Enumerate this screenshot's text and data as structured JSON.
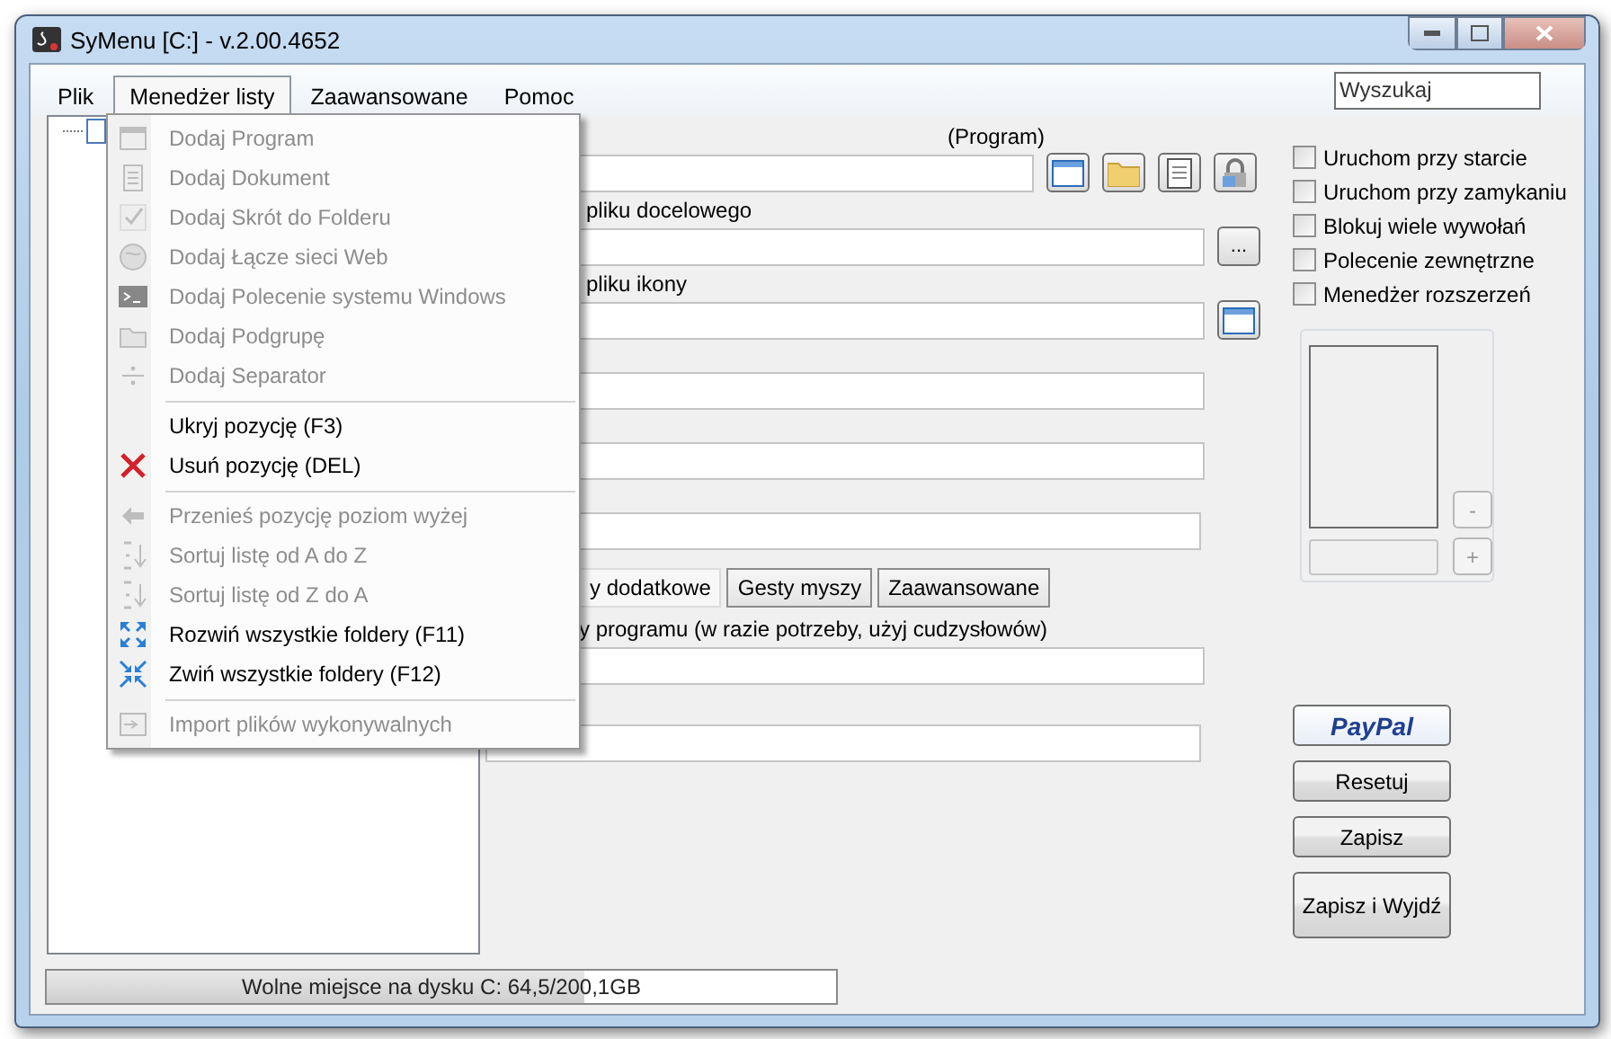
{
  "window": {
    "title": "SyMenu [C:] - v.2.00.4652"
  },
  "menu_bar": [
    {
      "label": "Plik",
      "selected": false
    },
    {
      "label": "Menedżer listy",
      "selected": true
    },
    {
      "label": "Zaawansowane",
      "selected": false
    },
    {
      "label": "Pomoc",
      "selected": false
    }
  ],
  "search": {
    "placeholder": "Wyszukaj"
  },
  "dropdown": [
    {
      "kind": "item",
      "label": "Dodaj Program",
      "disabled": true
    },
    {
      "kind": "item",
      "label": "Dodaj Dokument",
      "disabled": true
    },
    {
      "kind": "item",
      "label": "Dodaj Skrót do Folderu",
      "disabled": true
    },
    {
      "kind": "item",
      "label": "Dodaj Łącze sieci Web",
      "disabled": true
    },
    {
      "kind": "item",
      "label": "Dodaj Polecenie systemu Windows",
      "disabled": true
    },
    {
      "kind": "item",
      "label": "Dodaj Podgrupę",
      "disabled": true
    },
    {
      "kind": "item",
      "label": "Dodaj Separator",
      "disabled": true
    },
    {
      "kind": "separator"
    },
    {
      "kind": "item",
      "label": "Ukryj pozycję (F3)",
      "disabled": false
    },
    {
      "kind": "item",
      "label": "Usuń pozycję (DEL)",
      "disabled": false
    },
    {
      "kind": "separator"
    },
    {
      "kind": "item",
      "label": "Przenieś pozycję poziom wyżej",
      "disabled": true
    },
    {
      "kind": "item",
      "label": "Sortuj listę od A do Z",
      "disabled": true
    },
    {
      "kind": "item",
      "label": "Sortuj listę od Z do A",
      "disabled": true
    },
    {
      "kind": "item",
      "label": "Rozwiń wszystkie foldery (F11)",
      "disabled": false
    },
    {
      "kind": "item",
      "label": "Zwiń wszystkie foldery (F12)",
      "disabled": false
    },
    {
      "kind": "separator"
    },
    {
      "kind": "item",
      "label": "Import plików wykonywalnych",
      "disabled": true
    }
  ],
  "form": {
    "type_label": "(Program)",
    "target_label": "pliku docelowego",
    "browse_button": "...",
    "icon_label": "pliku ikony",
    "tabs": [
      {
        "label": "y dodatkowe",
        "selected": true
      },
      {
        "label": "Gesty myszy",
        "selected": false
      },
      {
        "label": "Zaawansowane",
        "selected": false
      }
    ],
    "args_label": "y programu (w razie potrzeby, użyj cudzysłowów)"
  },
  "options": [
    {
      "label": "Uruchom przy starcie",
      "checked": false
    },
    {
      "label": "Uruchom przy zamykaniu",
      "checked": false
    },
    {
      "label": "Blokuj wiele wywołań",
      "checked": false
    },
    {
      "label": "Polecenie zewnętrzne",
      "checked": false
    },
    {
      "label": "Menedżer rozszerzeń",
      "checked": false
    }
  ],
  "extensions": {
    "remove_button": "-",
    "add_button": "+"
  },
  "buttons": {
    "paypal": "PayPal",
    "reset": "Resetuj",
    "save": "Zapisz",
    "save_exit": "Zapisz i Wyjdź"
  },
  "status": {
    "text": "Wolne miejsce na dysku C: 64,5/200,1GB",
    "level": 0.68
  }
}
